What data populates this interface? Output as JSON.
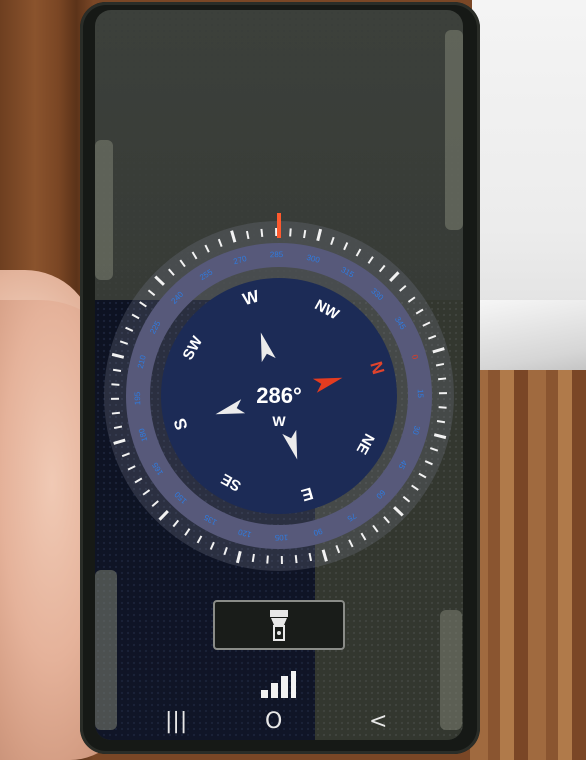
{
  "compass": {
    "heading_degrees": "286°",
    "heading_direction": "W",
    "cardinals": [
      {
        "label": "N",
        "angle": 0,
        "color": "#e0432c"
      },
      {
        "label": "NE",
        "angle": 45,
        "color": "#ffffff"
      },
      {
        "label": "E",
        "angle": 90,
        "color": "#ffffff"
      },
      {
        "label": "SE",
        "angle": 135,
        "color": "#ffffff"
      },
      {
        "label": "S",
        "angle": 180,
        "color": "#ffffff"
      },
      {
        "label": "SW",
        "angle": 225,
        "color": "#ffffff"
      },
      {
        "label": "W",
        "angle": 270,
        "color": "#ffffff"
      },
      {
        "label": "NW",
        "angle": 315,
        "color": "#ffffff"
      }
    ],
    "degree_labels": [
      "0",
      "15",
      "30",
      "45",
      "60",
      "75",
      "90",
      "105",
      "120",
      "135",
      "150",
      "165",
      "180",
      "195",
      "210",
      "225",
      "240",
      "255",
      "270",
      "285",
      "300",
      "315",
      "330",
      "345"
    ],
    "rotation_degrees": 74,
    "colors": {
      "face": "#1c2b56",
      "ring": "#57597a",
      "tick": "#f2f2f2",
      "degree_text": "#2e7be0",
      "north_needle": "#e43c20",
      "other_needles": "#ececec",
      "heading_marker": "#ff5a2e"
    }
  },
  "controls": {
    "flashlight_icon": "flashlight-icon",
    "signal_icon": "signal-bars-icon"
  },
  "navbar": {
    "recents": "|||",
    "home": "O",
    "back": "<"
  }
}
